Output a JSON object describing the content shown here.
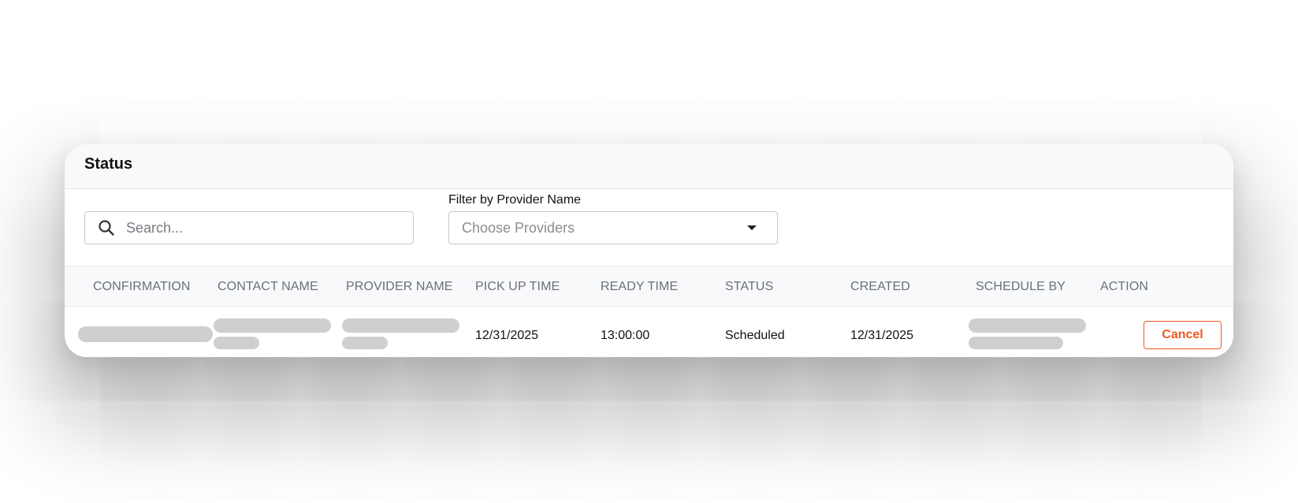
{
  "card": {
    "title": "Status"
  },
  "filters": {
    "search": {
      "placeholder": "Search...",
      "value": ""
    },
    "provider_filter": {
      "label": "Filter by Provider Name",
      "placeholder": "Choose Providers"
    }
  },
  "table": {
    "columns": [
      "CONFIRMATION",
      "CONTACT NAME",
      "PROVIDER NAME",
      "PICK UP TIME",
      "READY TIME",
      "STATUS",
      "CREATED",
      "SCHEDULE BY",
      "ACTION"
    ],
    "rows": [
      {
        "pick_up_time": "12/31/2025",
        "ready_time": "13:00:00",
        "status": "Scheduled",
        "created": "12/31/2025",
        "action_label": "Cancel"
      }
    ]
  },
  "colors": {
    "accent": "#ee5a24",
    "header_bg": "#f8f9fb",
    "skeleton": "#cfcfcf"
  },
  "icons": {
    "search": "search-icon",
    "dropdown": "caret-down-icon"
  }
}
